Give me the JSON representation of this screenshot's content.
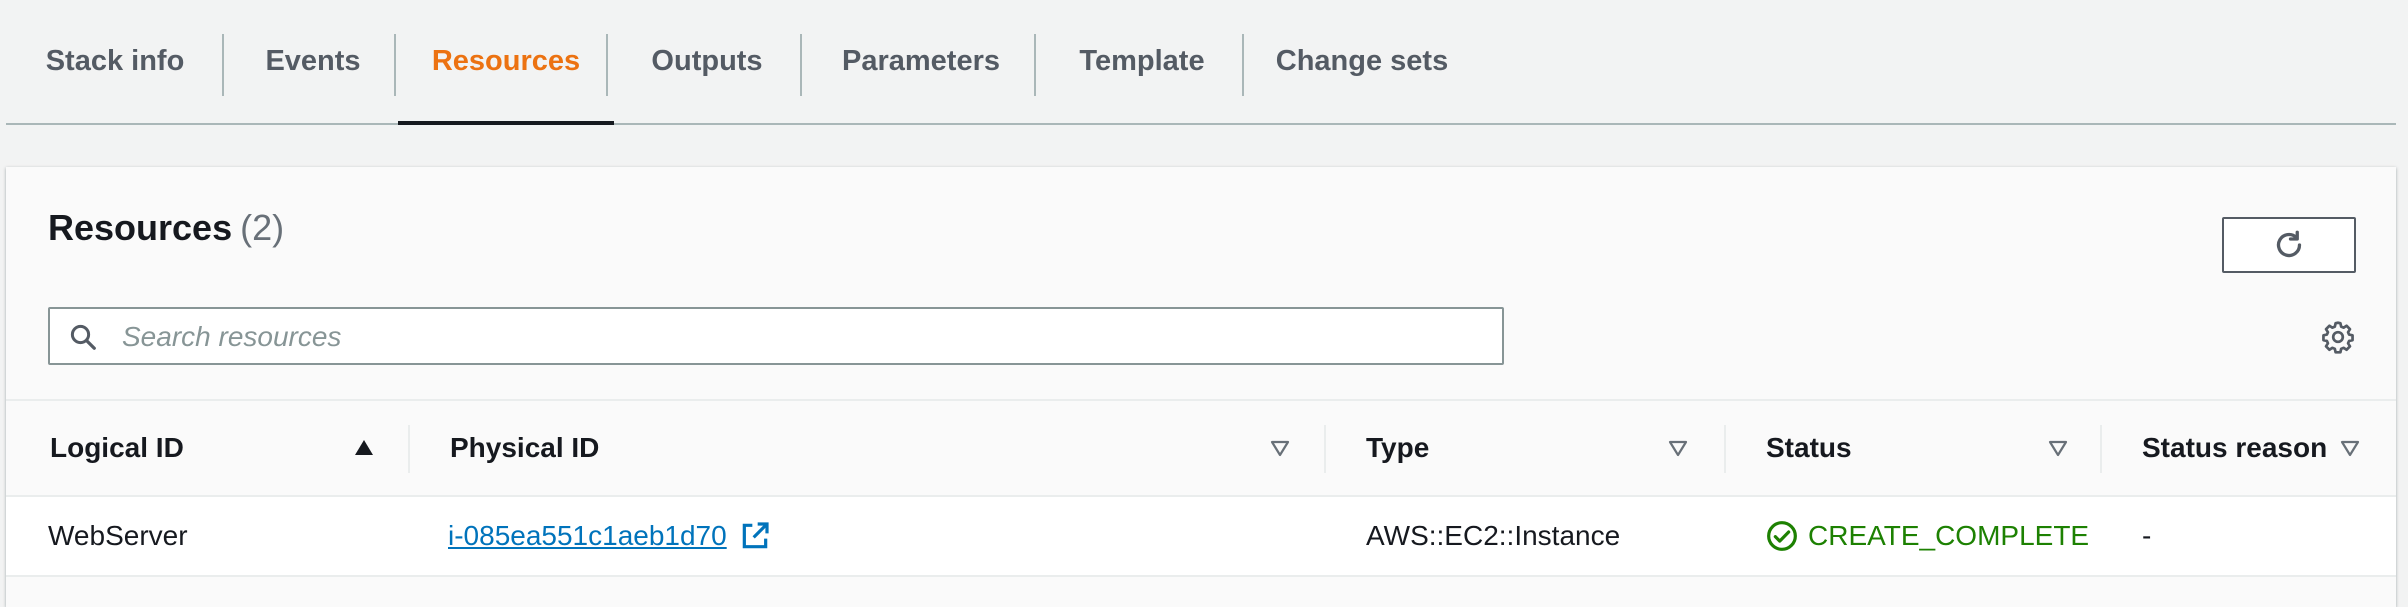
{
  "tabs": [
    {
      "label": "Stack info",
      "active": false
    },
    {
      "label": "Events",
      "active": false
    },
    {
      "label": "Resources",
      "active": true
    },
    {
      "label": "Outputs",
      "active": false
    },
    {
      "label": "Parameters",
      "active": false
    },
    {
      "label": "Template",
      "active": false
    },
    {
      "label": "Change sets",
      "active": false
    }
  ],
  "panel": {
    "title": "Resources",
    "count": "(2)",
    "refresh_icon": "refresh-icon",
    "settings_icon": "gear-icon"
  },
  "search": {
    "placeholder": "Search resources",
    "value": ""
  },
  "table": {
    "columns": [
      {
        "label": "Logical ID",
        "sort": "ascending"
      },
      {
        "label": "Physical ID",
        "sort": "none"
      },
      {
        "label": "Type",
        "sort": "none"
      },
      {
        "label": "Status",
        "sort": "none"
      },
      {
        "label": "Status reason",
        "sort": "none"
      }
    ],
    "rows": [
      {
        "logical_id": "WebServer",
        "physical_id": "i-085ea551c1aeb1d70",
        "type": "AWS::EC2::Instance",
        "status": "CREATE_COMPLETE",
        "status_reason": "-"
      }
    ]
  },
  "colors": {
    "active_tab": "#ec7211",
    "link": "#0073bb",
    "status_success": "#1d8102",
    "tab_text": "#545b64"
  }
}
